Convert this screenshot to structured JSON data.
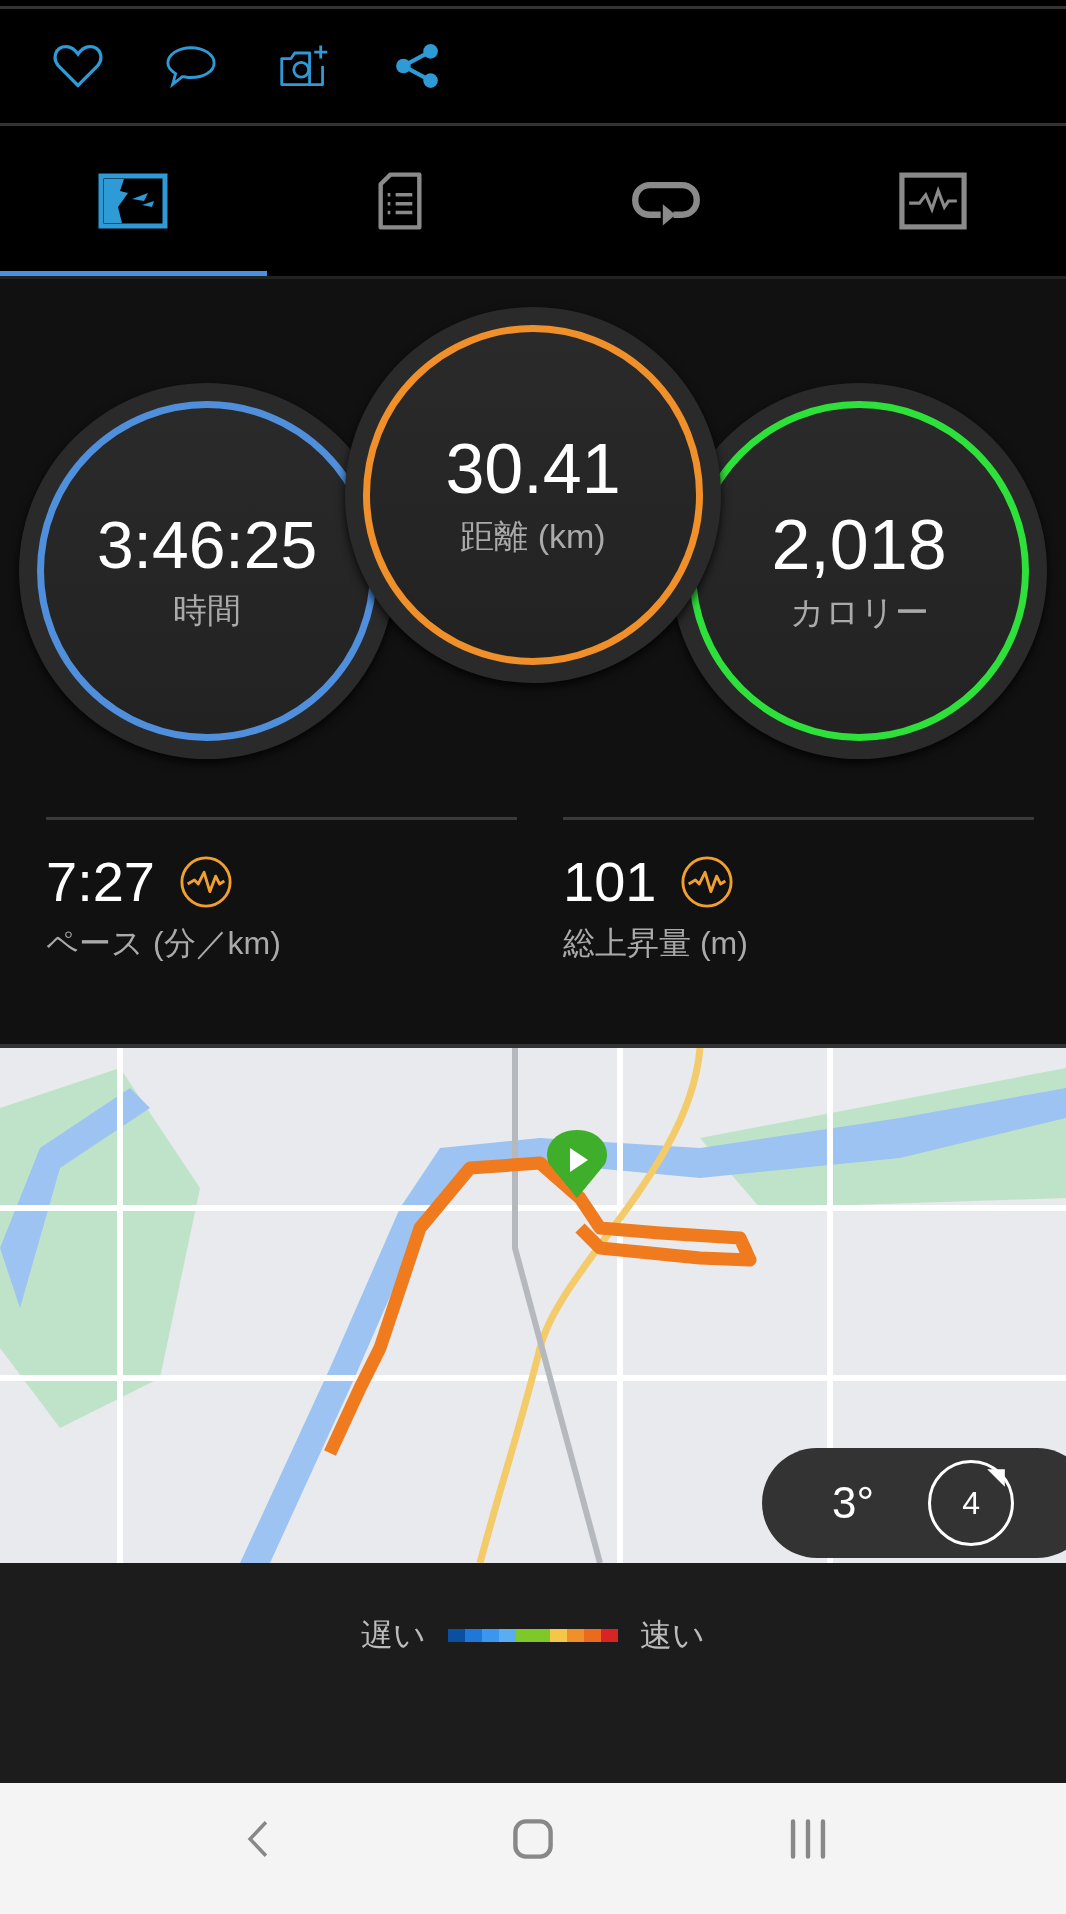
{
  "tabs": [
    {
      "kind": "map",
      "selected": true
    },
    {
      "kind": "details",
      "selected": false
    },
    {
      "kind": "laps",
      "selected": false
    },
    {
      "kind": "charts",
      "selected": false
    }
  ],
  "circles": [
    {
      "value": "3:46:25",
      "label": "時間",
      "color": "#4f8fdc"
    },
    {
      "value": "30.41",
      "label": "距離 (km)",
      "color": "#f0902a"
    },
    {
      "value": "2,018",
      "label": "カロリー",
      "color": "#2ee03a"
    }
  ],
  "stats": [
    {
      "value": "7:27",
      "label": "ペース (分／km)"
    },
    {
      "value": "101",
      "label": "総上昇量 (m)"
    }
  ],
  "map": {
    "kind": "picture",
    "temperature": "3°",
    "wind": "4"
  },
  "legend": {
    "slow": "遅い",
    "fast": "速い"
  }
}
